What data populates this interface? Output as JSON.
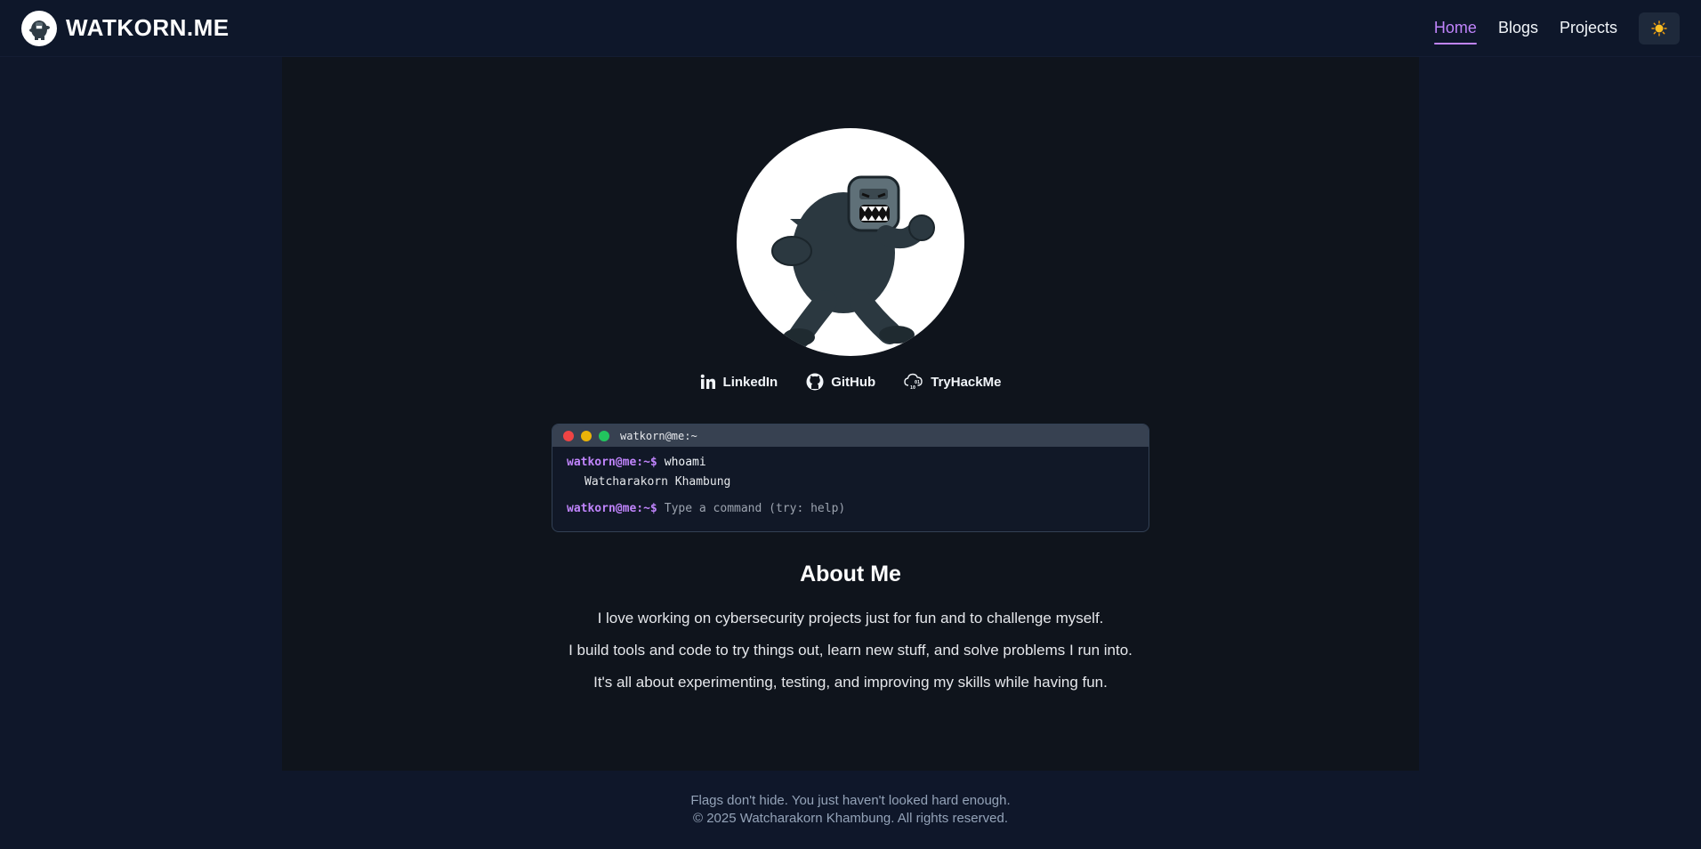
{
  "header": {
    "brand_name": "WATKORN.ME",
    "nav": [
      {
        "label": "Home",
        "active": true
      },
      {
        "label": "Blogs",
        "active": false
      },
      {
        "label": "Projects",
        "active": false
      }
    ],
    "theme_toggle_icon": "sun-icon"
  },
  "profile": {
    "avatar_icon": "yeti-mascot"
  },
  "socials": [
    {
      "label": "LinkedIn",
      "icon": "linkedin-icon"
    },
    {
      "label": "GitHub",
      "icon": "github-icon"
    },
    {
      "label": "TryHackMe",
      "icon": "tryhackme-icon"
    }
  ],
  "terminal": {
    "title": "watkorn@me:~",
    "prompt": "watkorn@me:~$",
    "history": [
      {
        "command": "whoami",
        "output": "Watcharakorn Khambung"
      }
    ],
    "input_placeholder": "Type a command (try: help)"
  },
  "about": {
    "title": "About Me",
    "lines": [
      "I love working on cybersecurity projects just for fun and to challenge myself.",
      "I build tools and code to try things out, learn new stuff, and solve problems I run into.",
      "It's all about experimenting, testing, and improving my skills while having fun."
    ]
  },
  "footer": {
    "tagline": "Flags don't hide. You just haven't looked hard enough.",
    "copyright": "© 2025 Watcharakorn Khambung. All rights reserved."
  },
  "colors": {
    "accent": "#c084fc",
    "background": "#0f172a",
    "panel": "#0f141c"
  }
}
